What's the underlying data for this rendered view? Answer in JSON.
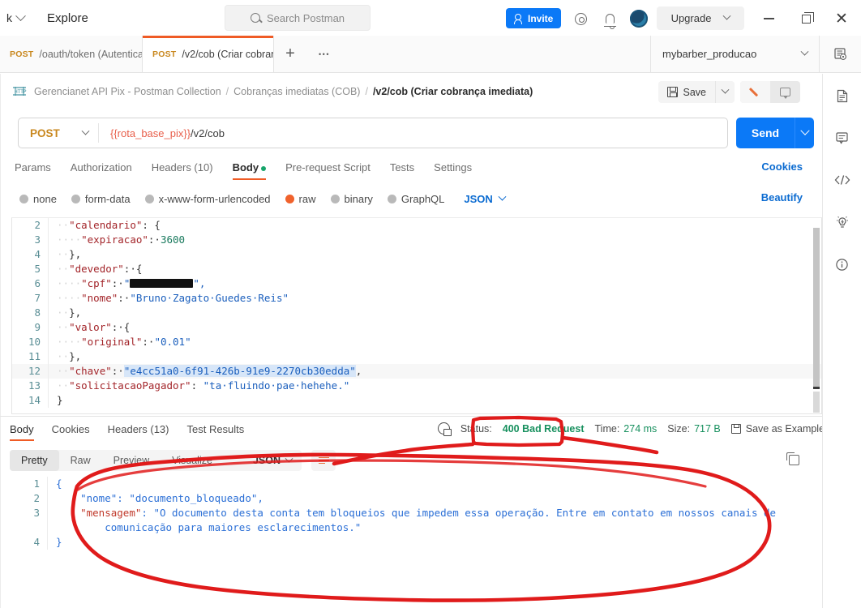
{
  "window": {
    "workspace_label": "k",
    "explore_label": "Explore",
    "search_placeholder": "Search Postman",
    "invite_label": "Invite",
    "upgrade_label": "Upgrade",
    "icons": {
      "gear": "gear-icon",
      "bell": "notifications-icon",
      "avatar": "user-avatar-icon",
      "minimize": "minimize-icon",
      "maximize": "maximize-icon",
      "close": "close-icon"
    }
  },
  "tabs": {
    "items": [
      {
        "method": "POST",
        "name": "/oauth/token (Autentica",
        "active": false,
        "unsaved": false
      },
      {
        "method": "POST",
        "name": "/v2/cob (Criar cobran",
        "active": true,
        "unsaved": true
      }
    ],
    "new_tab_label": "+",
    "more_label": "•••"
  },
  "environment": {
    "selected": "mybarber_producao"
  },
  "breadcrumb": {
    "items": [
      "Gerencianet API Pix - Postman Collection",
      "Cobranças imediatas (COB)",
      "/v2/cob (Criar cobrança imediata)"
    ],
    "separator": "/"
  },
  "request_actions": {
    "save_label": "Save"
  },
  "url_bar": {
    "method": "POST",
    "url_variable": "{{rota_base_pix}}",
    "url_path": "/v2/cob",
    "send_label": "Send"
  },
  "request_tabs": {
    "items": [
      {
        "label": "Params",
        "active": false
      },
      {
        "label": "Authorization",
        "active": false
      },
      {
        "label": "Headers (10)",
        "active": false
      },
      {
        "label": "Body",
        "active": true,
        "dot": true
      },
      {
        "label": "Pre-request Script",
        "active": false
      },
      {
        "label": "Tests",
        "active": false
      },
      {
        "label": "Settings",
        "active": false
      }
    ],
    "cookies_label": "Cookies"
  },
  "body_options": {
    "items": [
      {
        "label": "none",
        "selected": false
      },
      {
        "label": "form-data",
        "selected": false
      },
      {
        "label": "x-www-form-urlencoded",
        "selected": false
      },
      {
        "label": "raw",
        "selected": true
      },
      {
        "label": "binary",
        "selected": false
      },
      {
        "label": "GraphQL",
        "selected": false
      }
    ],
    "format": "JSON",
    "beautify_label": "Beautify"
  },
  "request_body_lines": [
    {
      "num": "2",
      "segments": [
        {
          "t": "··",
          "c": "dots"
        },
        {
          "t": "\"calendario\"",
          "c": "k"
        },
        {
          "t": ": {",
          "c": "p"
        }
      ]
    },
    {
      "num": "3",
      "segments": [
        {
          "t": "····",
          "c": "dots"
        },
        {
          "t": "\"expiracao\"",
          "c": "k"
        },
        {
          "t": ":·",
          "c": "p"
        },
        {
          "t": "3600",
          "c": "n"
        }
      ]
    },
    {
      "num": "4",
      "segments": [
        {
          "t": "··",
          "c": "dots"
        },
        {
          "t": "},",
          "c": "p"
        }
      ]
    },
    {
      "num": "5",
      "segments": [
        {
          "t": "··",
          "c": "dots"
        },
        {
          "t": "\"devedor\"",
          "c": "k"
        },
        {
          "t": ":·{",
          "c": "p"
        }
      ]
    },
    {
      "num": "6",
      "segments": [
        {
          "t": "····",
          "c": "dots"
        },
        {
          "t": "\"cpf\"",
          "c": "k"
        },
        {
          "t": ":·",
          "c": "p"
        },
        {
          "t": "\"",
          "c": "s"
        },
        {
          "t": "REDACTED",
          "c": "redacted"
        },
        {
          "t": "\",",
          "c": "s"
        }
      ]
    },
    {
      "num": "7",
      "segments": [
        {
          "t": "····",
          "c": "dots"
        },
        {
          "t": "\"nome\"",
          "c": "k"
        },
        {
          "t": ":·",
          "c": "p"
        },
        {
          "t": "\"Bruno·Zagato·Guedes·Reis\"",
          "c": "s"
        }
      ]
    },
    {
      "num": "8",
      "segments": [
        {
          "t": "··",
          "c": "dots"
        },
        {
          "t": "},",
          "c": "p"
        }
      ]
    },
    {
      "num": "9",
      "segments": [
        {
          "t": "··",
          "c": "dots"
        },
        {
          "t": "\"valor\"",
          "c": "k"
        },
        {
          "t": ":·{",
          "c": "p"
        }
      ]
    },
    {
      "num": "10",
      "segments": [
        {
          "t": "····",
          "c": "dots"
        },
        {
          "t": "\"original\"",
          "c": "k"
        },
        {
          "t": ":·",
          "c": "p"
        },
        {
          "t": "\"0.01\"",
          "c": "s"
        }
      ]
    },
    {
      "num": "11",
      "segments": [
        {
          "t": "··",
          "c": "dots"
        },
        {
          "t": "},",
          "c": "p"
        }
      ]
    },
    {
      "num": "12",
      "segments": [
        {
          "t": "··",
          "c": "dots"
        },
        {
          "t": "\"chave\"",
          "c": "k"
        },
        {
          "t": ":·",
          "c": "p"
        },
        {
          "t": "\"e4cc51a0-6f91-426b-91e9-2270cb30edda\"",
          "c": "s sel"
        },
        {
          "t": ",",
          "c": "p"
        }
      ],
      "highlight": true
    },
    {
      "num": "13",
      "segments": [
        {
          "t": "··",
          "c": "dots"
        },
        {
          "t": "\"solicitacaoPagador\"",
          "c": "k"
        },
        {
          "t": ": ",
          "c": "p"
        },
        {
          "t": "\"ta·fluindo·pae·hehehe.\"",
          "c": "s"
        }
      ]
    },
    {
      "num": "14",
      "segments": [
        {
          "t": "}",
          "c": "p"
        }
      ]
    }
  ],
  "response_tabs": {
    "items": [
      {
        "label": "Body",
        "active": true
      },
      {
        "label": "Cookies",
        "active": false
      },
      {
        "label": "Headers (13)",
        "active": false
      },
      {
        "label": "Test Results",
        "active": false
      }
    ]
  },
  "response_status": {
    "status_label": "Status:",
    "status_value": "400 Bad Request",
    "time_label": "Time:",
    "time_value": "274 ms",
    "size_label": "Size:",
    "size_value": "717 B",
    "save_example_label": "Save as Example",
    "more_label": "•••"
  },
  "response_format": {
    "modes": [
      {
        "label": "Pretty",
        "active": true
      },
      {
        "label": "Raw",
        "active": false
      },
      {
        "label": "Preview",
        "active": false
      },
      {
        "label": "Visualize",
        "active": false
      }
    ],
    "language": "JSON"
  },
  "response_body_lines": [
    {
      "num": "1",
      "segments": [
        {
          "t": "{",
          "c": "r-p"
        }
      ]
    },
    {
      "num": "2",
      "segments": [
        {
          "t": "    ",
          "c": "r-p"
        },
        {
          "t": "\"nome\"",
          "c": "r-s"
        },
        {
          "t": ": ",
          "c": "r-p"
        },
        {
          "t": "\"documento_bloqueado\",",
          "c": "r-s"
        }
      ]
    },
    {
      "num": "3",
      "segments": [
        {
          "t": "    ",
          "c": "r-p"
        },
        {
          "t": "\"mensagem\"",
          "c": "r-k"
        },
        {
          "t": ": ",
          "c": "r-p"
        },
        {
          "t": "\"O documento desta conta tem bloqueios que impedem essa operação. Entre em contato em nossos canais de",
          "c": "r-s"
        }
      ]
    },
    {
      "num": "",
      "segments": [
        {
          "t": "        ",
          "c": "r-p"
        },
        {
          "t": "comunicação para maiores esclarecimentos.\"",
          "c": "r-s"
        }
      ]
    },
    {
      "num": "4",
      "segments": [
        {
          "t": "}",
          "c": "r-p"
        }
      ]
    }
  ],
  "right_rail": {
    "items": [
      "documentation-icon",
      "comments-icon",
      "code-snippet-icon",
      "lightbulb-icon",
      "info-icon"
    ]
  },
  "annotations": {
    "color": "#e01b1b",
    "status_box": "400 Bad Request",
    "body_ellipse": "response body circled"
  }
}
